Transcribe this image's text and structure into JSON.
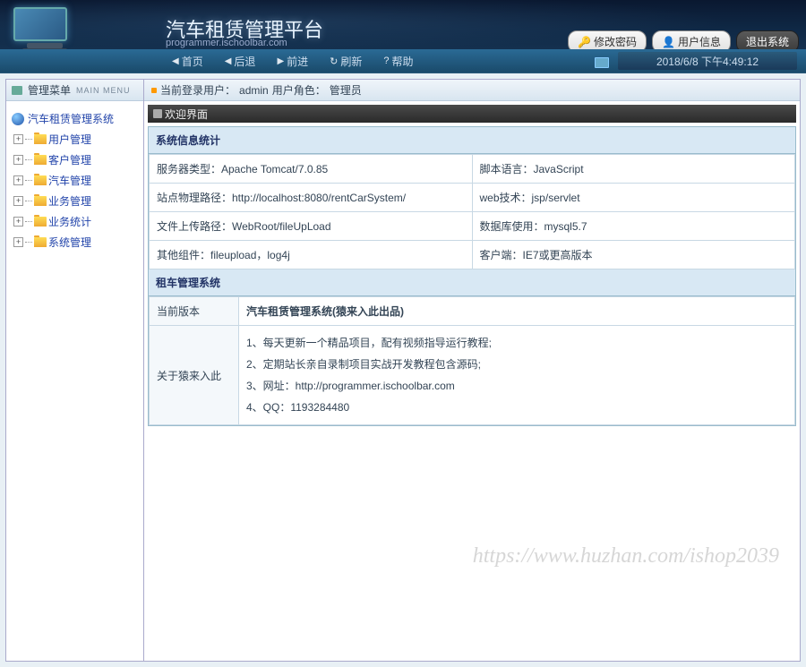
{
  "header": {
    "title": "汽车租赁管理平台",
    "subtitle": "programmer.ischoolbar.com",
    "buttons": {
      "change_password": "修改密码",
      "user_info": "用户信息",
      "logout": "退出系统"
    }
  },
  "nav": {
    "home": "首页",
    "back": "后退",
    "forward": "前进",
    "refresh": "刷新",
    "help": "帮助"
  },
  "datetime": "2018/6/8 下午4:49:12",
  "sidebar": {
    "header": "管理菜单",
    "header_sub": "MAIN MENU",
    "root": "汽车租赁管理系统",
    "nodes": [
      "用户管理",
      "客户管理",
      "汽车管理",
      "业务管理",
      "业务统计",
      "系统管理"
    ]
  },
  "status": {
    "prefix": "当前登录用户：",
    "user": "admin",
    "role_prefix": "  用户角色：",
    "role": "管理员"
  },
  "welcome_title": "欢迎界面",
  "sys_stats_title": "系统信息统计",
  "sys_rows": [
    {
      "l1": "服务器类型：Apache Tomcat/7.0.85",
      "l2": "脚本语言：JavaScript"
    },
    {
      "l1": "站点物理路径：http://localhost:8080/rentCarSystem/",
      "l2": "web技术：jsp/servlet"
    },
    {
      "l1": "文件上传路径：WebRoot/fileUpLoad",
      "l2": "数据库使用：mysql5.7"
    },
    {
      "l1": "其他组件：fileupload，log4j",
      "l2": "客户端：IE7或更高版本"
    }
  ],
  "rent_sys_title": "租车管理系统",
  "version": {
    "label": "当前版本",
    "value": "汽车租赁管理系统(猿来入此出品)"
  },
  "about": {
    "label": "关于猿来入此",
    "items": [
      "1、每天更新一个精品项目，配有视频指导运行教程;",
      "2、定期站长亲自录制项目实战开发教程包含源码;",
      "3、网址：http://programmer.ischoolbar.com",
      "4、QQ：1193284480"
    ]
  },
  "watermark": "https://www.huzhan.com/ishop2039"
}
